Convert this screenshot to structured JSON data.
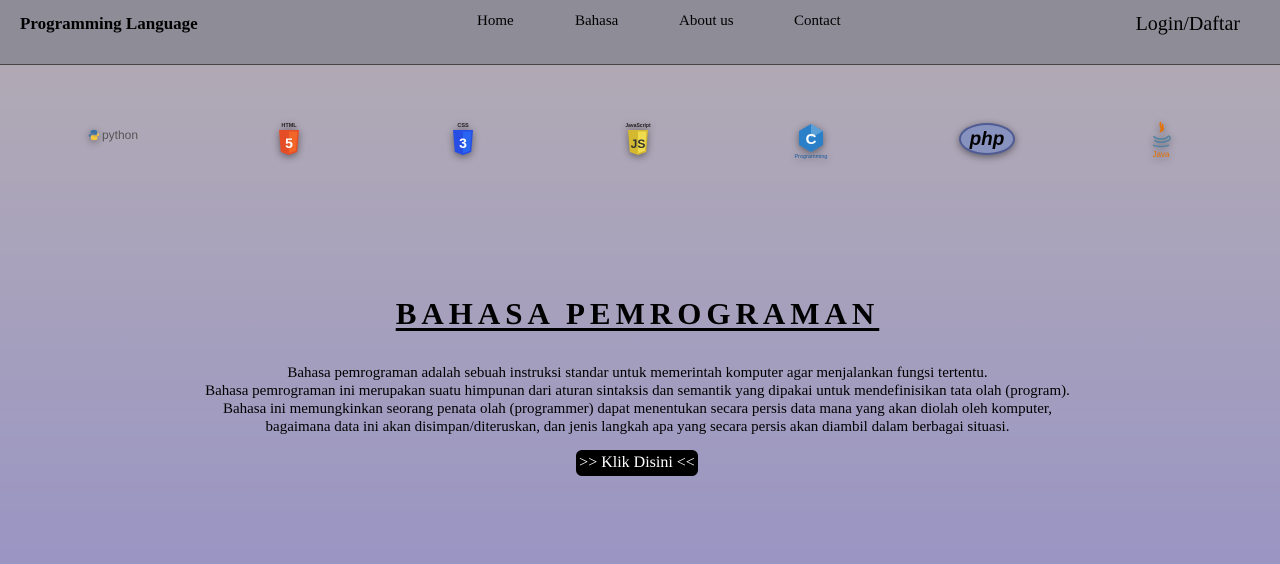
{
  "header": {
    "brand": "Programming Language",
    "nav": [
      "Home",
      "Bahasa",
      "About us",
      "Contact"
    ],
    "login": "Login/Daftar"
  },
  "logos": {
    "python": "python",
    "html": "HTML",
    "css": "CSS",
    "javascript": "JavaScript",
    "c": "C",
    "c_caption": "Programming",
    "php": "php",
    "java": "Java"
  },
  "main": {
    "title": "BAHASA PEMROGRAMAN",
    "lines": [
      "Bahasa pemrograman adalah sebuah instruksi standar untuk memerintah komputer agar menjalankan fungsi tertentu.",
      "Bahasa pemrograman ini merupakan suatu himpunan dari aturan sintaksis dan semantik yang dipakai untuk mendefinisikan tata olah (program).",
      "Bahasa ini memungkinkan seorang penata olah (programmer) dapat menentukan secara persis data mana yang akan diolah oleh komputer,",
      "bagaimana data ini akan disimpan/diteruskan, dan jenis langkah apa yang secara persis akan diambil dalam berbagai situasi."
    ],
    "cta": ">> Klik Disini <<"
  },
  "colors": {
    "navbar": "#8d8c97",
    "html": "#e44d26",
    "css": "#264de4",
    "javascript": "#f0db4f",
    "c": "#2a7fc9",
    "php": "#777bb3",
    "java": "#e76f00"
  }
}
